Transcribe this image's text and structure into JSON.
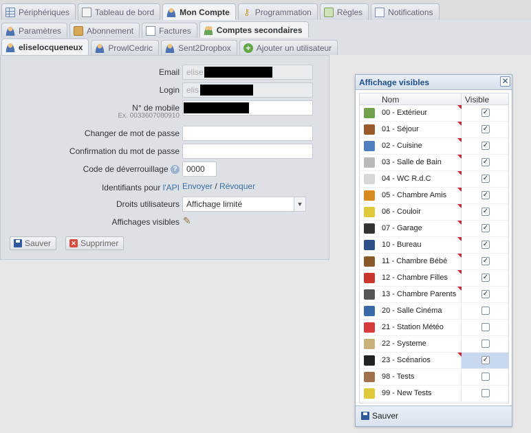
{
  "tabs_main": [
    {
      "label": "Périphériques",
      "icon": "grid-icon"
    },
    {
      "label": "Tableau de bord",
      "icon": "dashboard-icon"
    },
    {
      "label": "Mon Compte",
      "icon": "user-icon",
      "active": true
    },
    {
      "label": "Programmation",
      "icon": "key-icon"
    },
    {
      "label": "Règles",
      "icon": "rules-icon"
    },
    {
      "label": "Notifications",
      "icon": "mail-icon"
    }
  ],
  "tabs_account": [
    {
      "label": "Paramètres",
      "icon": "user-icon"
    },
    {
      "label": "Abonnement",
      "icon": "box-icon"
    },
    {
      "label": "Factures",
      "icon": "document-icon"
    },
    {
      "label": "Comptes secondaires",
      "icon": "users-icon",
      "active": true
    }
  ],
  "tabs_users": [
    {
      "label": "eliselocqueneux",
      "icon": "user-icon",
      "active": true
    },
    {
      "label": "ProwlCedric",
      "icon": "user-icon"
    },
    {
      "label": "Sent2Dropbox",
      "icon": "user-icon"
    },
    {
      "label": "Ajouter un utilisateur",
      "icon": "add-icon"
    }
  ],
  "form": {
    "email_label": "Email",
    "email_value": "elise",
    "login_label": "Login",
    "login_value": "elis",
    "mobile_label": "N° de mobile",
    "mobile_hint": "Ex. 0033607080910",
    "change_pwd_label": "Changer de mot de passe",
    "confirm_pwd_label": "Confirmation du mot de passe",
    "unlock_code_label": "Code de déverrouillage",
    "unlock_code_value": "0000",
    "api_label_prefix": "Identifiants pour ",
    "api_label_link": "l'API",
    "api_send": "Envoyer",
    "api_sep": " / ",
    "api_revoke": "Révoquer",
    "rights_label": "Droits utilisateurs",
    "rights_value": "Affichage limité",
    "visible_label": "Affichages visibles",
    "save_button": "Sauver",
    "delete_button": "Supprimer"
  },
  "dialog": {
    "title": "Affichage visibles",
    "col_name": "Nom",
    "col_visible": "Visible",
    "save_button": "Sauver",
    "rows": [
      {
        "name": "00 - Extérieur",
        "checked": true,
        "dirty": true,
        "color": "#6fa24a"
      },
      {
        "name": "01 - Séjour",
        "checked": true,
        "dirty": true,
        "color": "#9b5a2a"
      },
      {
        "name": "02 - Cuisine",
        "checked": true,
        "dirty": true,
        "color": "#4f7fc1"
      },
      {
        "name": "03 - Salle de Bain",
        "checked": true,
        "dirty": true,
        "color": "#b9b9b9"
      },
      {
        "name": "04 - WC R.d.C",
        "checked": true,
        "dirty": true,
        "color": "#d8d8d8"
      },
      {
        "name": "05 - Chambre Amis",
        "checked": true,
        "dirty": true,
        "color": "#d98a1f"
      },
      {
        "name": "06 - Couloir",
        "checked": true,
        "dirty": true,
        "color": "#e0c83a"
      },
      {
        "name": "07 - Garage",
        "checked": true,
        "dirty": true,
        "color": "#333333"
      },
      {
        "name": "10 - Bureau",
        "checked": true,
        "dirty": true,
        "color": "#2d4f8a"
      },
      {
        "name": "11 - Chambre Bébé",
        "checked": true,
        "dirty": true,
        "color": "#8a5a2b"
      },
      {
        "name": "12 - Chambre Filles",
        "checked": true,
        "dirty": true,
        "color": "#c8362c"
      },
      {
        "name": "13 - Chambre Parents",
        "checked": true,
        "dirty": true,
        "color": "#555555"
      },
      {
        "name": "20 - Salle Cinéma",
        "checked": false,
        "dirty": false,
        "color": "#3a6aa8"
      },
      {
        "name": "21 - Station Météo",
        "checked": false,
        "dirty": false,
        "color": "#d63a3a"
      },
      {
        "name": "22 - Systeme",
        "checked": false,
        "dirty": false,
        "color": "#c9b27a"
      },
      {
        "name": "23 - Scénarios",
        "checked": true,
        "dirty": true,
        "color": "#222222",
        "selected": true
      },
      {
        "name": "98 - Tests",
        "checked": false,
        "dirty": false,
        "color": "#a0714a"
      },
      {
        "name": "99 - New Tests",
        "checked": false,
        "dirty": false,
        "color": "#e0c83a"
      }
    ]
  }
}
